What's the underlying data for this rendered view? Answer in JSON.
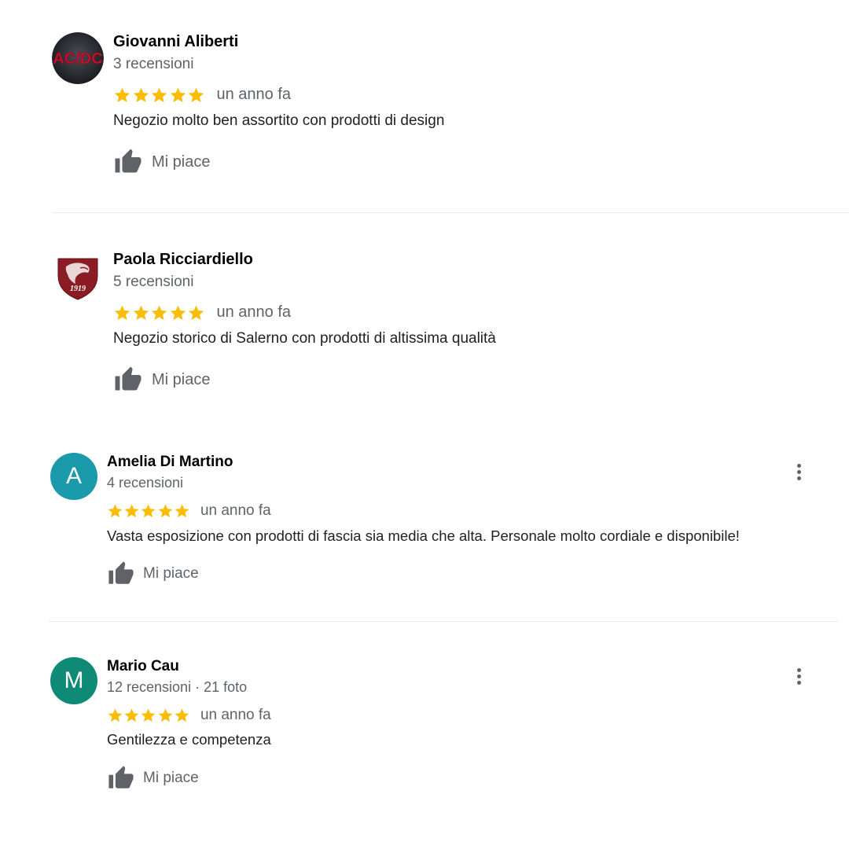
{
  "reviews": [
    {
      "name": "Giovanni Aliberti",
      "meta": "3 recensioni",
      "stars": 5,
      "time": "un anno fa",
      "text": "Negozio molto ben assortito con prodotti di design",
      "like_label": "Mi piace",
      "avatar_text": "AC/DC",
      "avatar_icon": "acdc-logo-avatar"
    },
    {
      "name": "Paola Ricciardiello",
      "meta": "5 recensioni",
      "stars": 5,
      "time": "un anno fa",
      "text": "Negozio storico di Salerno con prodotti di altissima qualità",
      "like_label": "Mi piace",
      "avatar_text": "1919",
      "avatar_icon": "salernitana-crest-avatar"
    },
    {
      "name": "Amelia Di Martino",
      "meta": "4 recensioni",
      "stars": 5,
      "time": "un anno fa",
      "text": "Vasta esposizione con prodotti di fascia sia media che alta. Personale molto cordiale e disponibile!",
      "like_label": "Mi piace",
      "avatar_letter": "A",
      "avatar_color": "#1a9aaa"
    },
    {
      "name": "Mario Cau",
      "meta": "12 recensioni · 21 foto",
      "stars": 5,
      "time": "un anno fa",
      "text": "Gentilezza e competenza",
      "like_label": "Mi piace",
      "avatar_letter": "M",
      "avatar_color": "#0f8a76"
    }
  ],
  "colors": {
    "star": "#fbbc04",
    "secondary_text": "#5f6368",
    "name_text": "#000000",
    "body_text": "#202124",
    "thumb_icon": "#5f6368",
    "divider": "#ebebeb"
  },
  "icons": {
    "star": "star-icon",
    "like": "thumbs-up-icon",
    "more": "more-vert-icon"
  }
}
